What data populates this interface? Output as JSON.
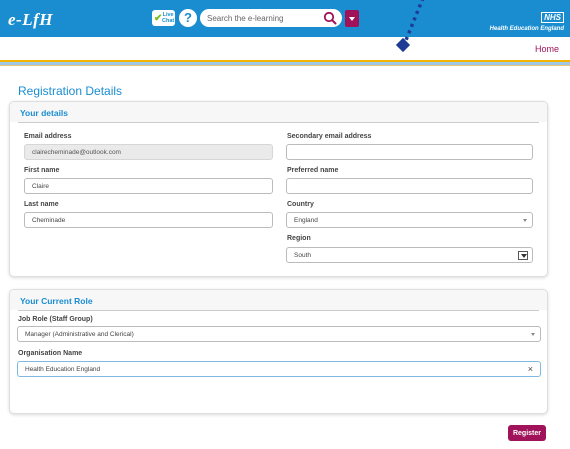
{
  "header": {
    "logo": "e-LfH",
    "live_chat_line1": "Live",
    "live_chat_line2": "Chat",
    "help_glyph": "?",
    "search_placeholder": "Search the e-learning",
    "nhs_badge": "NHS",
    "nhs_subtitle": "Health Education England",
    "home_link": "Home"
  },
  "page": {
    "title": "Registration Details"
  },
  "your_details": {
    "heading": "Your details",
    "email_label": "Email address",
    "email_value": "clairecheminade@outlook.com",
    "secondary_email_label": "Secondary email address",
    "secondary_email_value": "",
    "first_name_label": "First name",
    "first_name_value": "Claire",
    "preferred_name_label": "Preferred name",
    "preferred_name_value": "",
    "last_name_label": "Last name",
    "last_name_value": "Cheminade",
    "country_label": "Country",
    "country_value": "England",
    "region_label": "Region",
    "region_value": "South"
  },
  "current_role": {
    "heading": "Your Current Role",
    "job_role_label": "Job Role (Staff Group)",
    "job_role_value": "Manager (Administrative and Clerical)",
    "organisation_label": "Organisation Name",
    "organisation_value": "Health Education England",
    "clear_glyph": "×"
  },
  "actions": {
    "register_label": "Register"
  },
  "colors": {
    "header_blue": "#1a8dd1",
    "accent_magenta": "#a0135a",
    "stripe_yellow": "#f5b400"
  },
  "icons": [
    "live-chat-icon",
    "help-icon",
    "search-icon",
    "chevron-down-icon",
    "clear-icon"
  ]
}
